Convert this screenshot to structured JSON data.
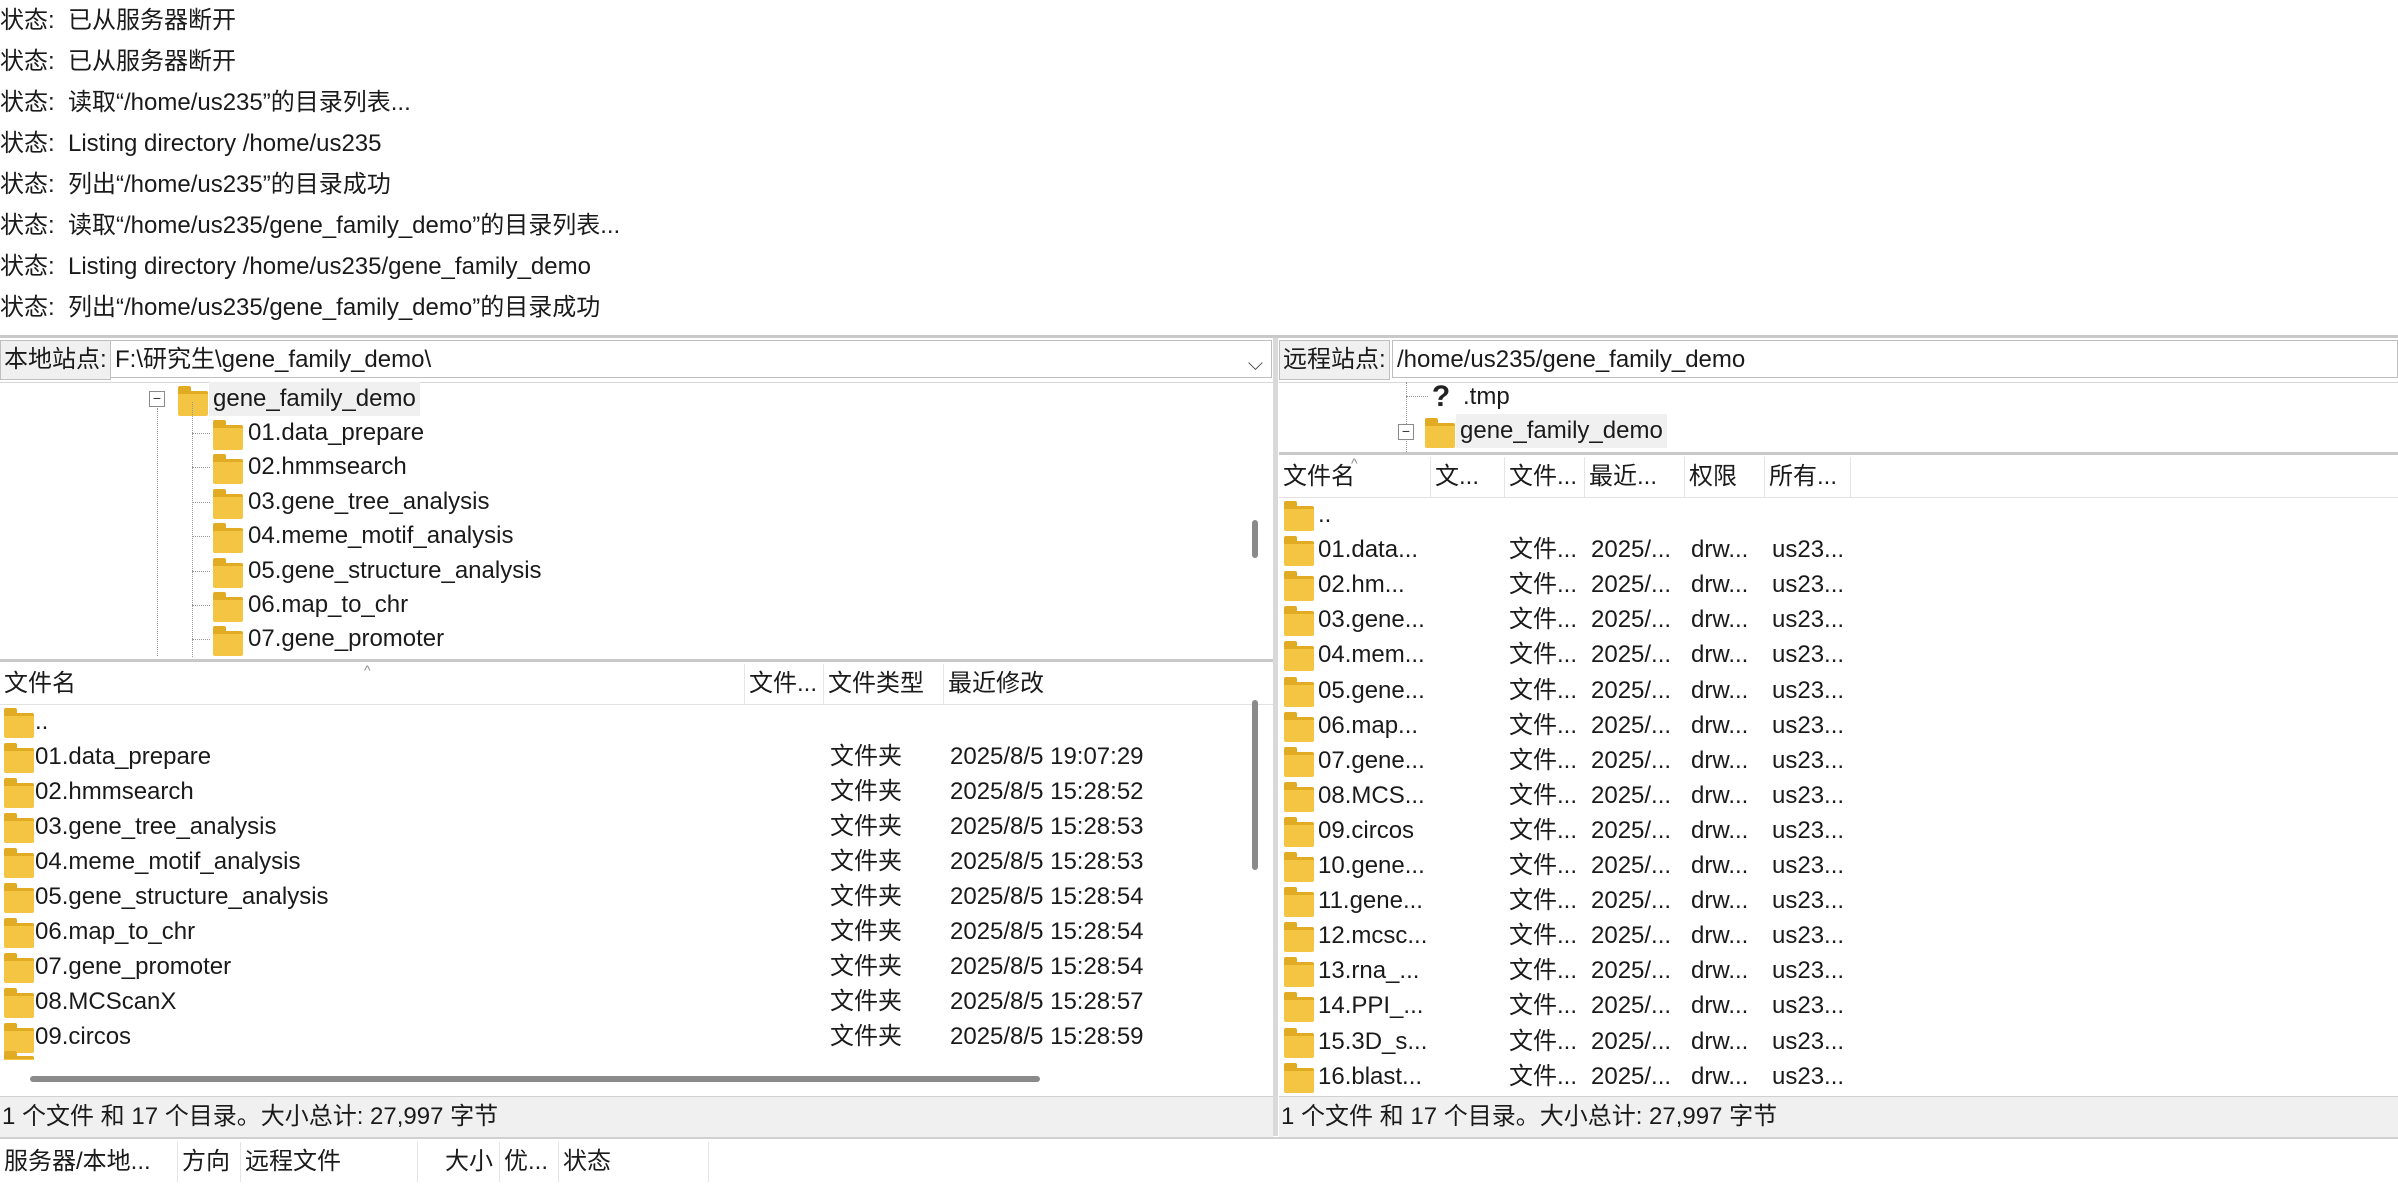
{
  "status_log": [
    {
      "label": "状态:",
      "message": "已从服务器断开"
    },
    {
      "label": "状态:",
      "message": "已从服务器断开"
    },
    {
      "label": "状态:",
      "message": "读取“/home/us235”的目录列表..."
    },
    {
      "label": "状态:",
      "message": "Listing directory /home/us235"
    },
    {
      "label": "状态:",
      "message": "列出“/home/us235”的目录成功"
    },
    {
      "label": "状态:",
      "message": "读取“/home/us235/gene_family_demo”的目录列表..."
    },
    {
      "label": "状态:",
      "message": "Listing directory /home/us235/gene_family_demo"
    },
    {
      "label": "状态:",
      "message": "列出“/home/us235/gene_family_demo”的目录成功"
    }
  ],
  "local": {
    "site_label": "本地站点:",
    "site_path": "F:\\研究生\\gene_family_demo\\",
    "dropdown_icon": "chevron-down-icon",
    "tree": {
      "root": "gene_family_demo",
      "children": [
        "01.data_prepare",
        "02.hmmsearch",
        "03.gene_tree_analysis",
        "04.meme_motif_analysis",
        "05.gene_structure_analysis",
        "06.map_to_chr",
        "07.gene_promoter"
      ]
    },
    "columns": [
      "文件名",
      "文件...",
      "文件类型",
      "最近修改"
    ],
    "rows": [
      {
        "name": "..",
        "size": "",
        "type": "",
        "modified": ""
      },
      {
        "name": "01.data_prepare",
        "size": "",
        "type": "文件夹",
        "modified": "2025/8/5 19:07:29"
      },
      {
        "name": "02.hmmsearch",
        "size": "",
        "type": "文件夹",
        "modified": "2025/8/5 15:28:52"
      },
      {
        "name": "03.gene_tree_analysis",
        "size": "",
        "type": "文件夹",
        "modified": "2025/8/5 15:28:53"
      },
      {
        "name": "04.meme_motif_analysis",
        "size": "",
        "type": "文件夹",
        "modified": "2025/8/5 15:28:53"
      },
      {
        "name": "05.gene_structure_analysis",
        "size": "",
        "type": "文件夹",
        "modified": "2025/8/5 15:28:54"
      },
      {
        "name": "06.map_to_chr",
        "size": "",
        "type": "文件夹",
        "modified": "2025/8/5 15:28:54"
      },
      {
        "name": "07.gene_promoter",
        "size": "",
        "type": "文件夹",
        "modified": "2025/8/5 15:28:54"
      },
      {
        "name": "08.MCScanX",
        "size": "",
        "type": "文件夹",
        "modified": "2025/8/5 15:28:57"
      },
      {
        "name": "09.circos",
        "size": "",
        "type": "文件夹",
        "modified": "2025/8/5 15:28:59"
      }
    ],
    "footer": "1 个文件 和 17 个目录。大小总计: 27,997 字节"
  },
  "remote": {
    "site_label": "远程站点:",
    "site_path": "/home/us235/gene_family_demo",
    "tree": {
      "unknown_item": ".tmp",
      "root": "gene_family_demo"
    },
    "columns": [
      "文件名",
      "文...",
      "文件...",
      "最近...",
      "权限",
      "所有..."
    ],
    "rows": [
      {
        "name": "..",
        "size": "",
        "type": "",
        "modified": "",
        "perm": "",
        "owner": ""
      },
      {
        "name": "01.data...",
        "size": "",
        "type": "文件...",
        "modified": "2025/...",
        "perm": "drw...",
        "owner": "us23..."
      },
      {
        "name": "02.hm...",
        "size": "",
        "type": "文件...",
        "modified": "2025/...",
        "perm": "drw...",
        "owner": "us23..."
      },
      {
        "name": "03.gene...",
        "size": "",
        "type": "文件...",
        "modified": "2025/...",
        "perm": "drw...",
        "owner": "us23..."
      },
      {
        "name": "04.mem...",
        "size": "",
        "type": "文件...",
        "modified": "2025/...",
        "perm": "drw...",
        "owner": "us23..."
      },
      {
        "name": "05.gene...",
        "size": "",
        "type": "文件...",
        "modified": "2025/...",
        "perm": "drw...",
        "owner": "us23..."
      },
      {
        "name": "06.map...",
        "size": "",
        "type": "文件...",
        "modified": "2025/...",
        "perm": "drw...",
        "owner": "us23..."
      },
      {
        "name": "07.gene...",
        "size": "",
        "type": "文件...",
        "modified": "2025/...",
        "perm": "drw...",
        "owner": "us23..."
      },
      {
        "name": "08.MCS...",
        "size": "",
        "type": "文件...",
        "modified": "2025/...",
        "perm": "drw...",
        "owner": "us23..."
      },
      {
        "name": "09.circos",
        "size": "",
        "type": "文件...",
        "modified": "2025/...",
        "perm": "drw...",
        "owner": "us23..."
      },
      {
        "name": "10.gene...",
        "size": "",
        "type": "文件...",
        "modified": "2025/...",
        "perm": "drw...",
        "owner": "us23..."
      },
      {
        "name": "11.gene...",
        "size": "",
        "type": "文件...",
        "modified": "2025/...",
        "perm": "drw...",
        "owner": "us23..."
      },
      {
        "name": "12.mcsc...",
        "size": "",
        "type": "文件...",
        "modified": "2025/...",
        "perm": "drw...",
        "owner": "us23..."
      },
      {
        "name": "13.rna_...",
        "size": "",
        "type": "文件...",
        "modified": "2025/...",
        "perm": "drw...",
        "owner": "us23..."
      },
      {
        "name": "14.PPI_...",
        "size": "",
        "type": "文件...",
        "modified": "2025/...",
        "perm": "drw...",
        "owner": "us23..."
      },
      {
        "name": "15.3D_s...",
        "size": "",
        "type": "文件...",
        "modified": "2025/...",
        "perm": "drw...",
        "owner": "us23..."
      },
      {
        "name": "16.blast...",
        "size": "",
        "type": "文件...",
        "modified": "2025/...",
        "perm": "drw...",
        "owner": "us23..."
      }
    ],
    "footer": "1 个文件 和 17 个目录。大小总计: 27,997 字节"
  },
  "queue": {
    "columns": [
      "服务器/本地...",
      "方向",
      "远程文件",
      "大小",
      "优...",
      "状态"
    ]
  }
}
